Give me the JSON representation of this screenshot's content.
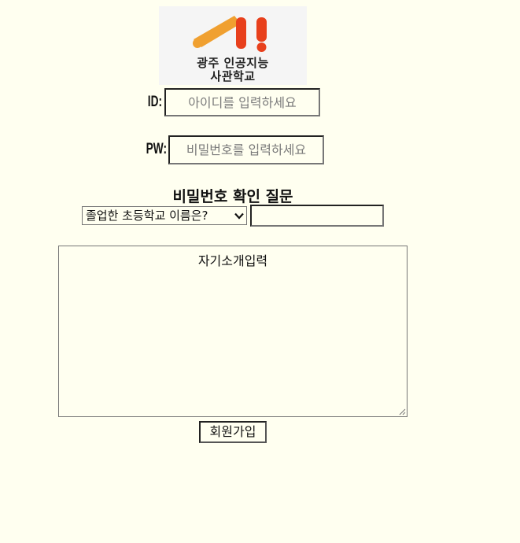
{
  "logo": {
    "line1": "광주 인공지능",
    "line2": "사관학교",
    "colors": {
      "orange": "#f0a030",
      "red": "#e8401c"
    }
  },
  "form": {
    "id_label": "ID:",
    "id_placeholder": "아이디를 입력하세요",
    "pw_label": "PW:",
    "pw_placeholder": "비밀번호를 입력하세요",
    "question_title": "비밀번호 확인 질문",
    "question_selected": "졸업한 초등학교 이름은?",
    "answer_value": "",
    "bio_placeholder": "자기소개입력",
    "submit_label": "회원가입"
  }
}
